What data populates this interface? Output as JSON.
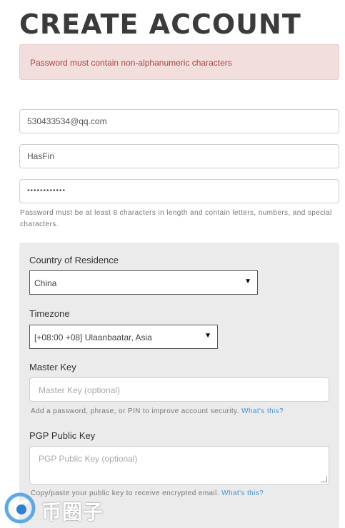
{
  "page": {
    "title": "CREATE ACCOUNT"
  },
  "alert": {
    "message": "Password must contain non-alphanumeric characters"
  },
  "form": {
    "email_value": "530433534@qq.com",
    "username_value": "HasFin",
    "password_value": "••••••••••••",
    "password_help": "Password must be at least 8 characters in length and contain letters, numbers, and special characters."
  },
  "panel": {
    "country_label": "Country of Residence",
    "country_value": "China",
    "timezone_label": "Timezone",
    "timezone_value": "[+08:00 +08] Ulaanbaatar, Asia",
    "master_key_label": "Master Key",
    "master_key_placeholder": "Master Key (optional)",
    "master_key_help": "Add a password, phrase, or PIN to improve account security.",
    "master_key_link": "What's this?",
    "pgp_label": "PGP Public Key",
    "pgp_placeholder": "PGP Public Key (optional)",
    "pgp_help": "Copy/paste your public key to receive encrypted email.",
    "pgp_link": "What's this?"
  },
  "watermark": {
    "text": "币圈子"
  },
  "icons": {
    "caret": "caret-down-icon",
    "logo": "watermark-logo-icon"
  }
}
